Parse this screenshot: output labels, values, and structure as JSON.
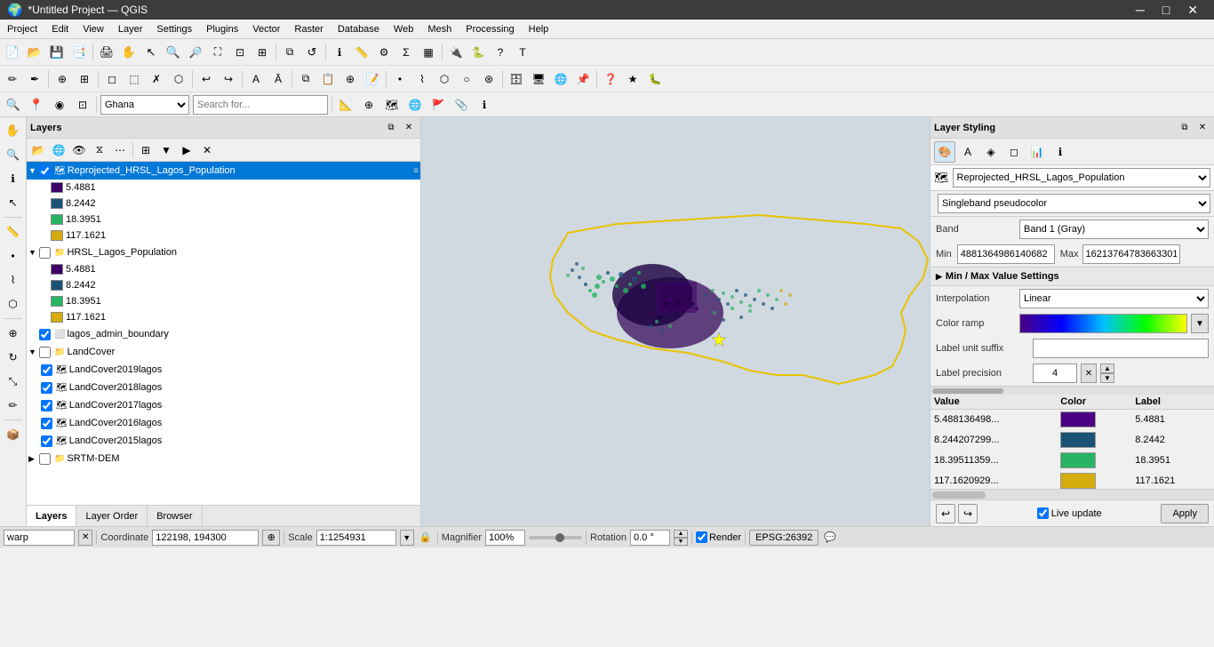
{
  "titleBar": {
    "title": "*Untitled Project — QGIS",
    "minimize": "─",
    "maximize": "□",
    "close": "✕"
  },
  "menuBar": {
    "items": [
      "Project",
      "Edit",
      "View",
      "Layer",
      "Settings",
      "Plugins",
      "Vector",
      "Raster",
      "Database",
      "Web",
      "Mesh",
      "Processing",
      "Help"
    ]
  },
  "locationBar": {
    "location": "Ghana",
    "searchPlaceholder": "Search for..."
  },
  "layers": {
    "title": "Layers",
    "items": [
      {
        "id": "reprojected",
        "name": "Reprojected_HRSL_Lagos_Population",
        "indent": 0,
        "selected": true,
        "checked": true,
        "expanded": true,
        "type": "raster"
      },
      {
        "id": "swatch1a",
        "name": "5.4881",
        "indent": 1,
        "type": "swatch",
        "color": "#3d0066"
      },
      {
        "id": "swatch2a",
        "name": "8.2442",
        "indent": 1,
        "type": "swatch",
        "color": "#1a5276"
      },
      {
        "id": "swatch3a",
        "name": "18.3951",
        "indent": 1,
        "type": "swatch",
        "color": "#28b463"
      },
      {
        "id": "swatch4a",
        "name": "117.1621",
        "indent": 1,
        "type": "swatch",
        "color": "#d4ac0d"
      },
      {
        "id": "hrsl",
        "name": "HRSL_Lagos_Population",
        "indent": 0,
        "checked": false,
        "expanded": true,
        "type": "group"
      },
      {
        "id": "swatch1b",
        "name": "5.4881",
        "indent": 1,
        "type": "swatch",
        "color": "#3d0066"
      },
      {
        "id": "swatch2b",
        "name": "8.2442",
        "indent": 1,
        "type": "swatch",
        "color": "#1a5276"
      },
      {
        "id": "swatch3b",
        "name": "18.3951",
        "indent": 1,
        "type": "swatch",
        "color": "#28b463"
      },
      {
        "id": "swatch4b",
        "name": "117.1621",
        "indent": 1,
        "type": "swatch",
        "color": "#d4ac0d"
      },
      {
        "id": "lagos_admin",
        "name": "lagos_admin_boundary",
        "indent": 0,
        "checked": true,
        "expanded": false,
        "type": "vector"
      },
      {
        "id": "landcover",
        "name": "LandCover",
        "indent": 0,
        "checked": false,
        "expanded": true,
        "type": "group"
      },
      {
        "id": "lc2019",
        "name": "LandCover2019lagos",
        "indent": 1,
        "checked": true,
        "type": "raster"
      },
      {
        "id": "lc2018",
        "name": "LandCover2018lagos",
        "indent": 1,
        "checked": true,
        "type": "raster"
      },
      {
        "id": "lc2017",
        "name": "LandCover2017lagos",
        "indent": 1,
        "checked": true,
        "type": "raster"
      },
      {
        "id": "lc2016",
        "name": "LandCover2016lagos",
        "indent": 1,
        "checked": true,
        "type": "raster"
      },
      {
        "id": "lc2015",
        "name": "LandCover2015lagos",
        "indent": 1,
        "checked": true,
        "type": "raster"
      },
      {
        "id": "srtm",
        "name": "SRTM-DEM",
        "indent": 0,
        "checked": false,
        "expanded": false,
        "type": "group"
      }
    ]
  },
  "bottomTabs": [
    "Layers",
    "Layer Order",
    "Browser"
  ],
  "activeTab": "Layers",
  "statusBar": {
    "warpLabel": "warp",
    "coordinateLabel": "Coordinate",
    "coordinate": "122198, 194300",
    "scaleLabel": "Scale",
    "scale": "1:1254931",
    "magnifierLabel": "Magnifier",
    "magnifier": "100%",
    "rotationLabel": "Rotation",
    "rotation": "0.0 °",
    "renderLabel": "Render",
    "epsg": "EPSG:26392"
  },
  "layerStyling": {
    "title": "Layer Styling",
    "layerName": "Reprojected_HRSL_Lagos_Population",
    "renderType": "Singleband pseudocolor",
    "bandLabel": "Band",
    "band": "Band 1 (Gray)",
    "minLabel": "Min",
    "minValue": "4881364986140682",
    "maxLabel": "Max",
    "maxValue": "16213764783663301",
    "minMaxSection": "Min / Max Value Settings",
    "interpolationLabel": "Interpolation",
    "interpolation": "Linear",
    "colorRampLabel": "Color ramp",
    "labelUnitLabel": "Label unit suffix",
    "labelUnit": "",
    "labelPrecisionLabel": "Label precision",
    "labelPrecision": "4",
    "tableHeaders": [
      "Value",
      "Color",
      "Label"
    ],
    "colorEntries": [
      {
        "value": "5.488136498...",
        "color": "#4b0082",
        "label": "5.4881"
      },
      {
        "value": "8.244207299...",
        "color": "#1a5276",
        "label": "8.2442"
      },
      {
        "value": "18.39511359...",
        "color": "#28b463",
        "label": "18.3951"
      },
      {
        "value": "117.1620929...",
        "color": "#d4ac0d",
        "label": "117.1621"
      }
    ],
    "liveUpdateLabel": "Live update",
    "applyLabel": "Apply"
  }
}
